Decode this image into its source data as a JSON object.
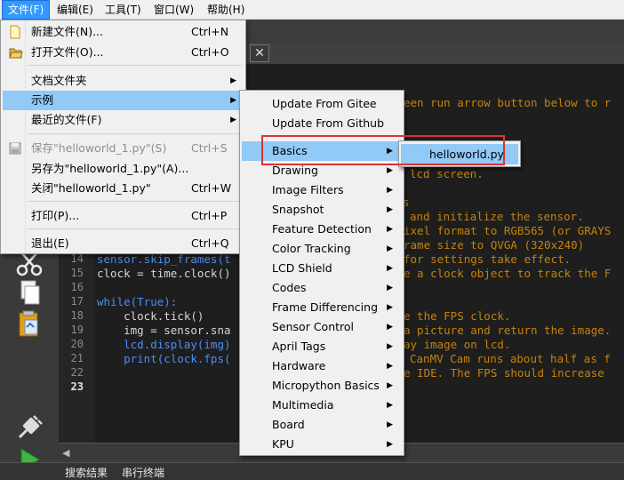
{
  "menubar": {
    "items": [
      "文件(F)",
      "编辑(E)",
      "工具(T)",
      "窗口(W)",
      "帮助(H)"
    ]
  },
  "file_menu": {
    "items": [
      {
        "label": "新建文件(N)...",
        "shortcut": "Ctrl+N",
        "icon": "new-file-icon"
      },
      {
        "label": "打开文件(O)...",
        "shortcut": "Ctrl+O",
        "icon": "open-folder-icon"
      },
      {
        "label": "文档文件夹",
        "submenu": true
      },
      {
        "label": "示例",
        "submenu": true,
        "highlighted": true
      },
      {
        "label": "最近的文件(F)",
        "submenu": true
      },
      {
        "label": "保存\"helloworld_1.py\"(S)",
        "shortcut": "Ctrl+S",
        "disabled": true,
        "icon": "save-icon"
      },
      {
        "label": "另存为\"helloworld_1.py\"(A)...",
        "shortcut": ""
      },
      {
        "label": "关闭\"helloworld_1.py\"",
        "shortcut": "Ctrl+W"
      },
      {
        "label": "打印(P)...",
        "shortcut": "Ctrl+P"
      },
      {
        "label": "退出(E)",
        "shortcut": "Ctrl+Q"
      }
    ]
  },
  "examples_menu": {
    "items": [
      {
        "label": "Update From Gitee",
        "submenu": false
      },
      {
        "label": "Update From Github",
        "submenu": false
      },
      {
        "label": "Basics",
        "submenu": true,
        "highlighted": true
      },
      {
        "label": "Drawing",
        "submenu": true
      },
      {
        "label": "Image Filters",
        "submenu": true
      },
      {
        "label": "Snapshot",
        "submenu": true
      },
      {
        "label": "Feature Detection",
        "submenu": true
      },
      {
        "label": "Color Tracking",
        "submenu": true
      },
      {
        "label": "LCD Shield",
        "submenu": true
      },
      {
        "label": "Codes",
        "submenu": true
      },
      {
        "label": "Frame Differencing",
        "submenu": true
      },
      {
        "label": "Sensor Control",
        "submenu": true
      },
      {
        "label": "April Tags",
        "submenu": true
      },
      {
        "label": "Hardware",
        "submenu": true
      },
      {
        "label": "Micropython Basics",
        "submenu": true
      },
      {
        "label": "Multimedia",
        "submenu": true
      },
      {
        "label": "Board",
        "submenu": true
      },
      {
        "label": "KPU",
        "submenu": true
      }
    ]
  },
  "basics_menu": {
    "items": [
      {
        "label": "helloworld.py",
        "highlighted": true
      }
    ]
  },
  "tab_close": "✕",
  "editor": {
    "line_numbers": [
      "14",
      "15",
      "16",
      "17",
      "18",
      "19",
      "20",
      "21",
      "22",
      "23"
    ],
    "current_line": "23",
    "visible_fragments": [
      "een run arrow button below to r",
      "lcd screen.",
      "s",
      "and initialize the sensor.",
      "ixel format to RGB565 (or GRAYS",
      "rame size to QVGA (320x240)",
      "for settings take effect.",
      "e a clock object to track the F",
      "e the FPS clock.",
      "a picture and return the image.",
      "ay image on lcd.",
      "CanMV Cam runs about half as f",
      "e IDE. The FPS should increase"
    ],
    "code_lines": [
      {
        "line": "14",
        "text": "sensor.skip_frames(t"
      },
      {
        "line": "15",
        "text": "clock = time.clock()"
      },
      {
        "line": "17",
        "text": "while(True):"
      },
      {
        "line": "18",
        "text": "    clock.tick()"
      },
      {
        "line": "19",
        "text": "    img = sensor.sna"
      },
      {
        "line": "20",
        "text": "    lcd.display(img)"
      },
      {
        "line": "21",
        "text": "    print(clock.fps("
      }
    ]
  },
  "bottom_tabs": [
    "搜索结果",
    "串行终端"
  ],
  "colors": {
    "menu_highlight": "#91c9f7",
    "menubar_open": "#3399ff",
    "comment": "#c5820c",
    "keyword": "#4b8ef0",
    "annotation_box": "#e03030"
  }
}
